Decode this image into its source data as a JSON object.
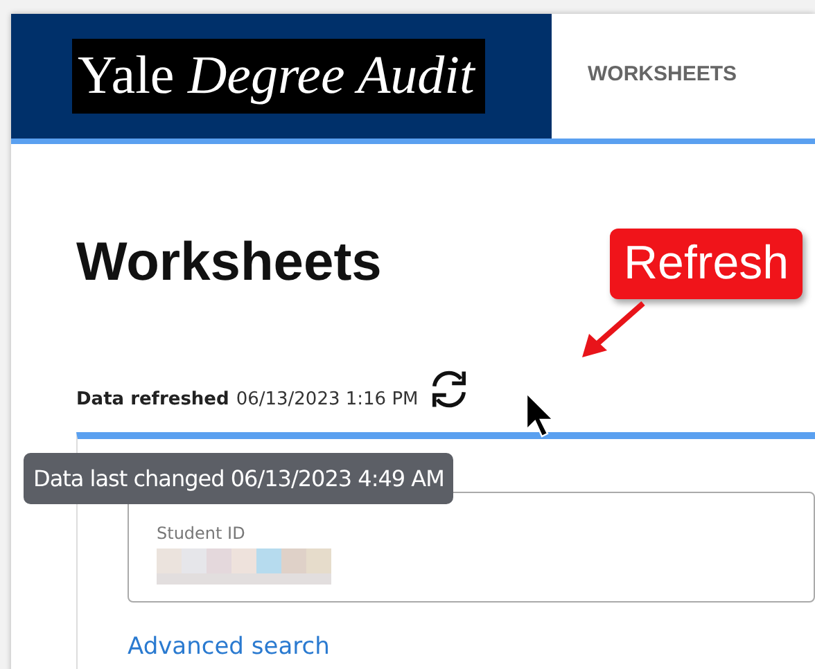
{
  "header": {
    "logo": "Yale *Degree Audit*",
    "tabs": [
      {
        "label": "WORKSHEETS",
        "selected": false
      }
    ]
  },
  "title": "Worksheets",
  "refresh": {
    "label": "Data refreshed",
    "value": "06/13/2023 1:16 PM"
  },
  "tooltip": "Data last changed 06/13/2023 4:49 AM",
  "callout": "Refresh",
  "search": {
    "field_label": "Student ID",
    "link": "Advanced search"
  }
}
